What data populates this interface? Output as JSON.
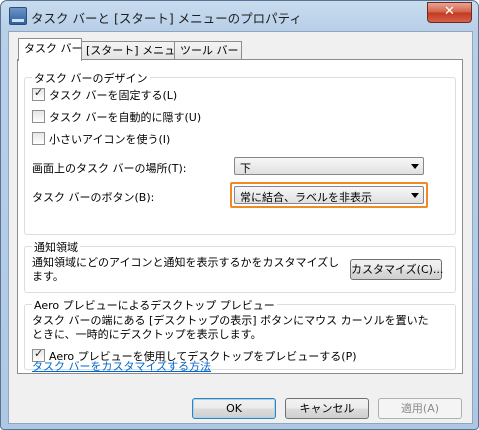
{
  "window": {
    "title": "タスク バーと [スタート] メニューのプロパティ",
    "close_label": "✕"
  },
  "tabs": [
    {
      "label": "タスク バー"
    },
    {
      "label": "[スタート] メニュー"
    },
    {
      "label": "ツール バー"
    }
  ],
  "design": {
    "title": "タスク バーのデザイン",
    "lock": {
      "label": "タスク バーを固定する(L)",
      "checked": true
    },
    "autohide": {
      "label": "タスク バーを自動的に隠す(U)",
      "checked": false
    },
    "small_icons": {
      "label": "小さいアイコンを使う(I)",
      "checked": false
    },
    "location_label": "画面上のタスク バーの場所(T):",
    "location_value": "下",
    "buttons_label": "タスク バーのボタン(B):",
    "buttons_value": "常に結合、ラベルを非表示"
  },
  "notify": {
    "title": "通知領域",
    "description": "通知領域にどのアイコンと通知を表示するかをカスタマイズします。",
    "customize_button": "カスタマイズ(C)..."
  },
  "aero": {
    "title": "Aero プレビューによるデスクトップ プレビュー",
    "description": "タスク バーの端にある [デスクトップの表示] ボタンにマウス カーソルを置いたときに、一時的にデスクトップを表示します。",
    "checkbox": {
      "label": "Aero プレビューを使用してデスクトップをプレビューする(P)",
      "checked": true
    }
  },
  "help_link": "タスク バーをカスタマイズする方法",
  "footer": {
    "ok": "OK",
    "cancel": "キャンセル",
    "apply": "適用(A)"
  },
  "colors": {
    "highlight": "#f08a24",
    "link": "#0066cc"
  }
}
